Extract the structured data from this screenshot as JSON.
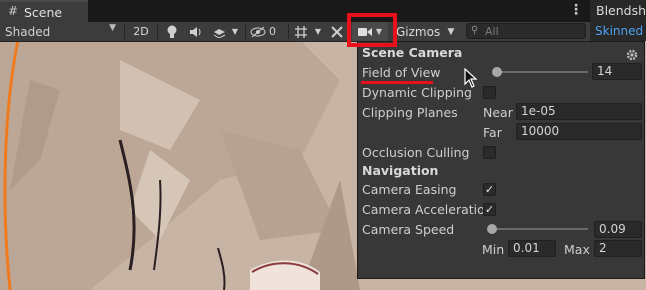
{
  "scene_tab": {
    "icon": "hash-grid-icon",
    "label": "Scene"
  },
  "right_panel": {
    "tab_label": "Blendsha",
    "toolbar_label": "Skinned I"
  },
  "toolbar": {
    "shading_mode": "Shaded",
    "mode_2d": "2D",
    "hidden_count": "0",
    "gizmos_label": "Gizmos",
    "search_placeholder": "All",
    "icons": [
      "lightbulb-icon",
      "audio-icon",
      "effects-icon",
      "scene-visibility-icon",
      "grid-icon",
      "tools-icon",
      "camera-icon"
    ]
  },
  "scene_camera": {
    "title": "Scene Camera",
    "field_of_view": {
      "label": "Field of View",
      "value": "14",
      "slider_fraction": 0.02
    },
    "dynamic_clipping": {
      "label": "Dynamic Clipping",
      "checked": false
    },
    "clipping_planes": {
      "label": "Clipping Planes",
      "near_label": "Near",
      "near_value": "1e-05",
      "far_label": "Far",
      "far_value": "10000"
    },
    "occlusion_culling": {
      "label": "Occlusion Culling",
      "checked": false
    },
    "navigation_title": "Navigation",
    "camera_easing": {
      "label": "Camera Easing",
      "checked": true
    },
    "camera_acceleration": {
      "label": "Camera Acceleration",
      "checked": true
    },
    "camera_speed": {
      "label": "Camera Speed",
      "value": "0.09",
      "slider_fraction": 0.0,
      "min_label": "Min",
      "min_value": "0.01",
      "max_label": "Max",
      "max_value": "2"
    }
  },
  "colors": {
    "highlight": "#e8101c",
    "panel_bg": "#383838",
    "toolbar_bg": "#3c3c3c",
    "link_blue": "#4ea0ef",
    "selection_orange": "#f07a1e"
  }
}
